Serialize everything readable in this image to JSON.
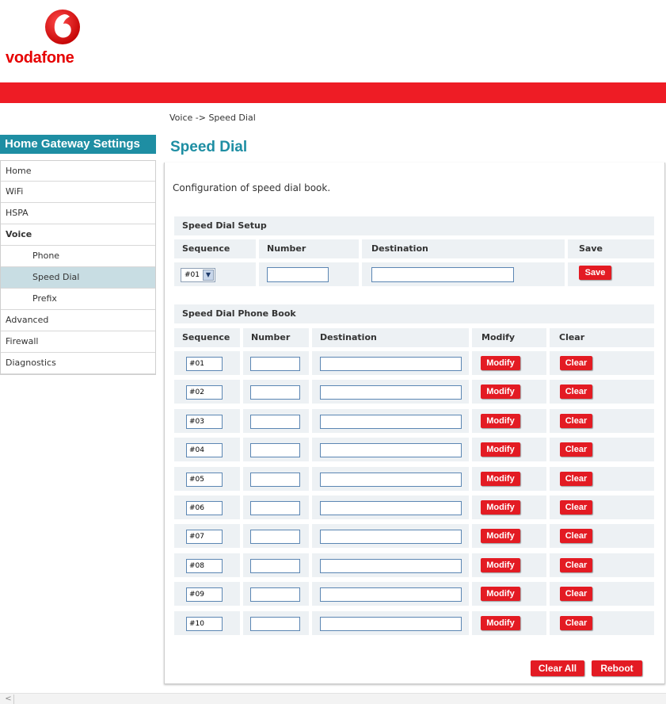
{
  "brand": {
    "name": "vodafone",
    "color": "#e60000"
  },
  "breadcrumb": "Voice -> Speed Dial",
  "sidebar": {
    "title": "Home Gateway Settings",
    "items": [
      {
        "label": "Home"
      },
      {
        "label": "WiFi"
      },
      {
        "label": "HSPA"
      },
      {
        "label": "Voice"
      },
      {
        "label": "Phone"
      },
      {
        "label": "Speed Dial"
      },
      {
        "label": "Prefix"
      },
      {
        "label": "Advanced"
      },
      {
        "label": "Firewall"
      },
      {
        "label": "Diagnostics"
      }
    ]
  },
  "page": {
    "title": "Speed Dial",
    "description": "Configuration of speed dial book."
  },
  "setup": {
    "heading": "Speed Dial Setup",
    "col_sequence": "Sequence",
    "col_number": "Number",
    "col_destination": "Destination",
    "col_save": "Save",
    "sequence_value": "#01",
    "number_value": "",
    "destination_value": "",
    "save_label": "Save"
  },
  "phonebook": {
    "heading": "Speed Dial Phone Book",
    "col_sequence": "Sequence",
    "col_number": "Number",
    "col_destination": "Destination",
    "col_modify": "Modify",
    "col_clear": "Clear",
    "rows": [
      {
        "seq": "#01",
        "number": "",
        "destination": ""
      },
      {
        "seq": "#02",
        "number": "",
        "destination": ""
      },
      {
        "seq": "#03",
        "number": "",
        "destination": ""
      },
      {
        "seq": "#04",
        "number": "",
        "destination": ""
      },
      {
        "seq": "#05",
        "number": "",
        "destination": ""
      },
      {
        "seq": "#06",
        "number": "",
        "destination": ""
      },
      {
        "seq": "#07",
        "number": "",
        "destination": ""
      },
      {
        "seq": "#08",
        "number": "",
        "destination": ""
      },
      {
        "seq": "#09",
        "number": "",
        "destination": ""
      },
      {
        "seq": "#10",
        "number": "",
        "destination": ""
      }
    ],
    "modify_label": "Modify",
    "clear_label": "Clear"
  },
  "footer": {
    "clear_all_label": "Clear All",
    "reboot_label": "Reboot"
  },
  "scrollbar": {
    "left_arrow": "<"
  }
}
